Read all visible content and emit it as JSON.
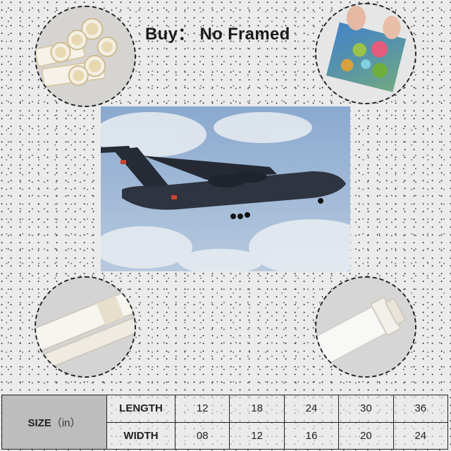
{
  "headline": "Buy： No Framed",
  "size_table": {
    "title": "SIZE",
    "unit": "（in）",
    "rows": [
      {
        "label": "LENGTH",
        "values": [
          "12",
          "18",
          "24",
          "30",
          "36"
        ]
      },
      {
        "label": "WIDTH",
        "values": [
          "08",
          "12",
          "16",
          "20",
          "24"
        ]
      }
    ]
  },
  "colors": {
    "background": "#ecebeb",
    "sky": "#9fb8d6",
    "aircraft": "#2e3440",
    "table_header": "#bdbdbd"
  },
  "images": {
    "top_left": "white-pvc-tubes",
    "top_right": "hands-holding-canvas-print",
    "center": "military-transport-aircraft-in-sky",
    "bottom_left": "white-tube-rolled",
    "bottom_right": "white-tube-end-cap"
  }
}
